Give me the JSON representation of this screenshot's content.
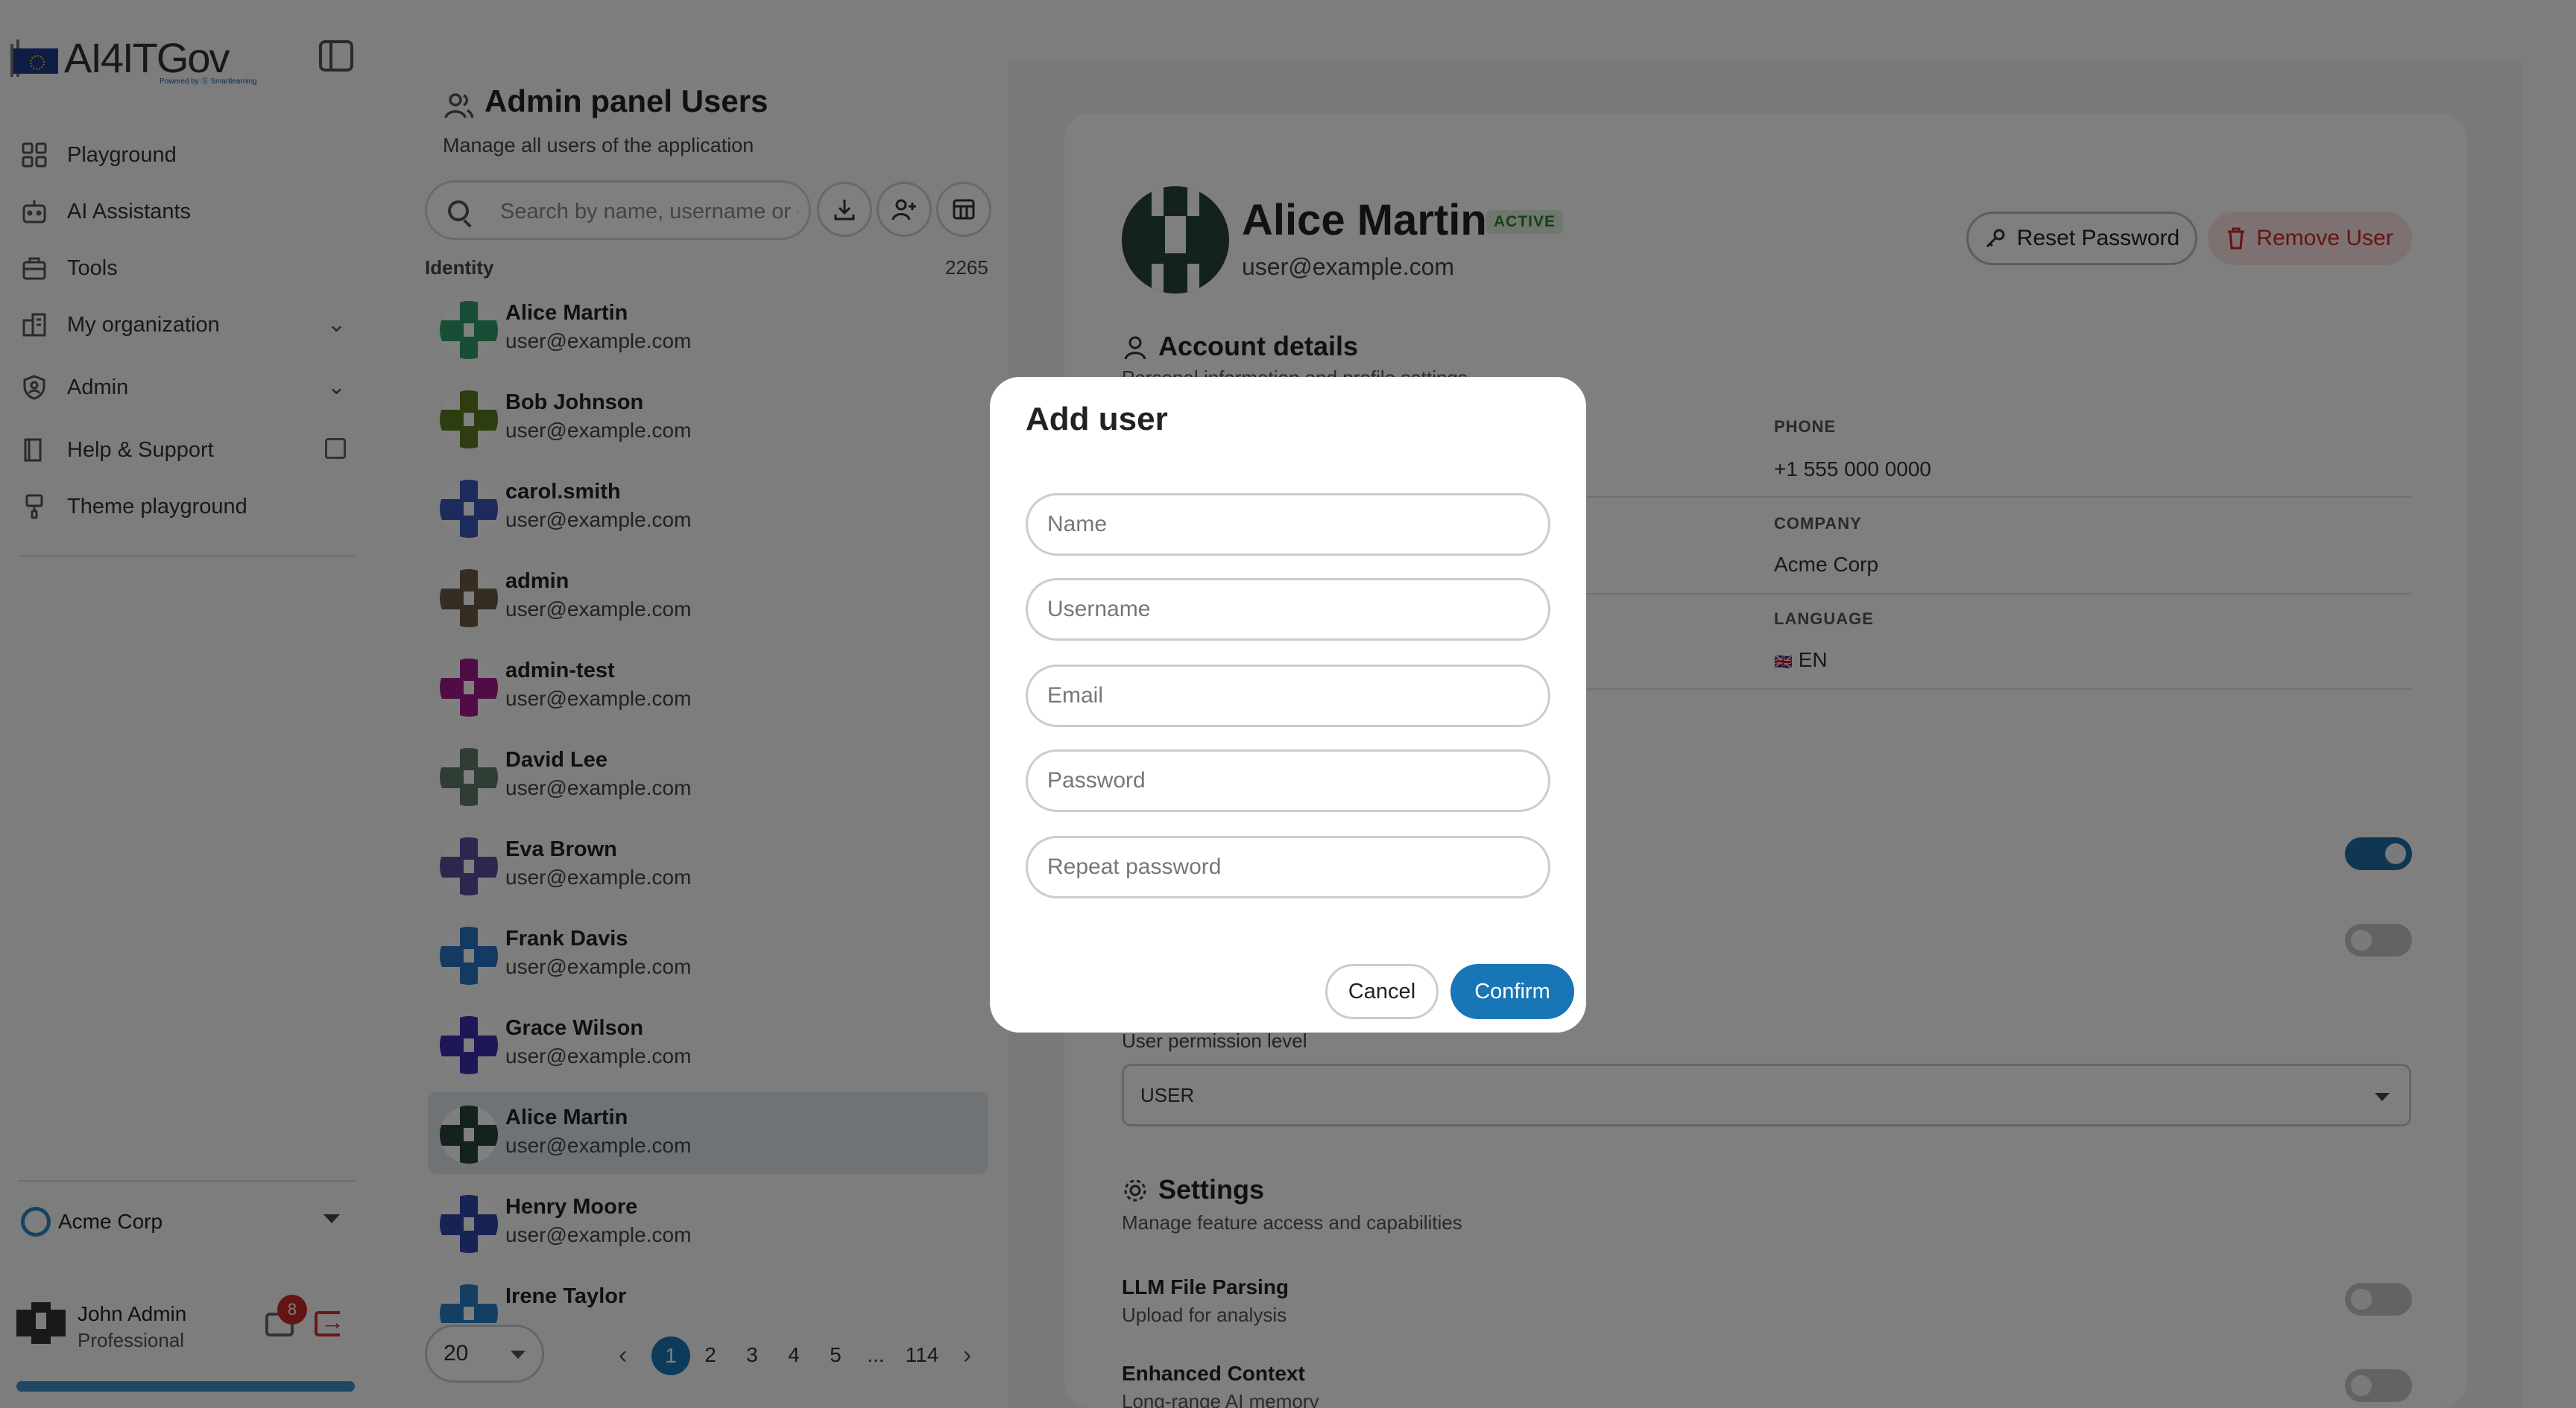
{
  "app": {
    "logo_text": "AI4ITGov",
    "logo_sub": "Powered by Ⓢ Smartlearning"
  },
  "sidebar": {
    "items": [
      {
        "label": "Playground",
        "icon": "grid-icon"
      },
      {
        "label": "AI Assistants",
        "icon": "robot-icon"
      },
      {
        "label": "Tools",
        "icon": "toolbox-icon"
      },
      {
        "label": "My organization",
        "icon": "building-icon",
        "expandable": true
      },
      {
        "label": "Admin",
        "icon": "shield-user-icon",
        "expandable": true
      },
      {
        "label": "Help & Support",
        "icon": "book-icon",
        "external": true
      },
      {
        "label": "Theme playground",
        "icon": "brush-icon"
      }
    ],
    "organization": "Acme Corp",
    "current_user": {
      "name": "John Admin",
      "plan": "Professional",
      "notifications": "8"
    },
    "usage_progress": 1.0
  },
  "users_panel": {
    "title": "Admin panel Users",
    "subtitle": "Manage all users of the application",
    "search_placeholder": "Search by name, username or email",
    "column_identity": "Identity",
    "total_count": "2265",
    "users": [
      {
        "name": "Alice Martin",
        "email": "user@example.com",
        "avatar_color": "#2e9c6a",
        "selected": false
      },
      {
        "name": "Bob Johnson",
        "email": "user@example.com",
        "avatar_color": "#5c7a1e",
        "selected": false
      },
      {
        "name": "carol.smith",
        "email": "user@example.com",
        "avatar_color": "#3a56b8",
        "selected": false
      },
      {
        "name": "admin",
        "email": "user@example.com",
        "avatar_color": "#6b5a45",
        "selected": false
      },
      {
        "name": "admin-test",
        "email": "user@example.com",
        "avatar_color": "#a11a8a",
        "selected": false
      },
      {
        "name": "David Lee",
        "email": "user@example.com",
        "avatar_color": "#5f7a68",
        "selected": false
      },
      {
        "name": "Eva Brown",
        "email": "user@example.com",
        "avatar_color": "#5a4fa0",
        "selected": false
      },
      {
        "name": "Frank Davis",
        "email": "user@example.com",
        "avatar_color": "#2a74c4",
        "selected": false
      },
      {
        "name": "Grace Wilson",
        "email": "user@example.com",
        "avatar_color": "#3b2fb0",
        "selected": false
      },
      {
        "name": "Alice Martin",
        "email": "user@example.com",
        "avatar_color": "#27453a",
        "selected": true
      },
      {
        "name": "Henry Moore",
        "email": "user@example.com",
        "avatar_color": "#2f46a8",
        "selected": false
      },
      {
        "name": "Irene Taylor",
        "email": "",
        "avatar_color": "#2a7fc4",
        "selected": false
      }
    ],
    "page_size": "20",
    "pages": [
      "1",
      "2",
      "3",
      "4",
      "5",
      "...",
      "114"
    ],
    "current_page": "1"
  },
  "detail": {
    "name": "Alice Martin",
    "status": "ACTIVE",
    "email": "user@example.com",
    "reset_password": "Reset Password",
    "remove_user": "Remove User",
    "account_details_title": "Account details",
    "account_details_sub": "Personal information and profile settings",
    "fields": [
      {
        "label": "PHONE",
        "value": "+1 555 000 0000"
      },
      {
        "label": "COMPANY",
        "value": "Acme Corp"
      },
      {
        "label": "LANGUAGE",
        "value": "EN",
        "flag": "🇬🇧"
      }
    ],
    "toggle_states": [
      true,
      false
    ],
    "permission_label": "User permission level",
    "permission_value": "USER",
    "settings_title": "Settings",
    "settings_sub": "Manage feature access and capabilities",
    "features": [
      {
        "title": "LLM File Parsing",
        "desc": "Upload for analysis",
        "enabled": false
      },
      {
        "title": "Enhanced Context",
        "desc": "Long-range AI memory",
        "enabled": false
      }
    ]
  },
  "modal": {
    "title": "Add user",
    "fields": [
      {
        "placeholder": "Name",
        "value": ""
      },
      {
        "placeholder": "Username",
        "value": ""
      },
      {
        "placeholder": "Email",
        "value": ""
      },
      {
        "placeholder": "Password",
        "value": ""
      },
      {
        "placeholder": "Repeat password",
        "value": ""
      }
    ],
    "cancel": "Cancel",
    "confirm": "Confirm"
  }
}
